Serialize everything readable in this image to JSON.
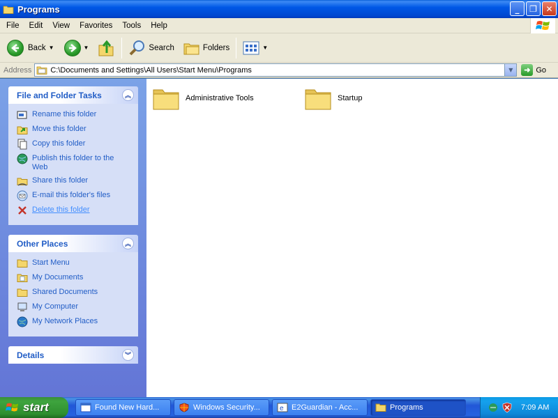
{
  "window": {
    "title": "Programs",
    "minimize_label": "_",
    "maximize_label": "❐",
    "close_label": "✕"
  },
  "menu": [
    "File",
    "Edit",
    "View",
    "Favorites",
    "Tools",
    "Help"
  ],
  "toolbar": {
    "back_label": "Back",
    "search_label": "Search",
    "folders_label": "Folders"
  },
  "address": {
    "label": "Address",
    "value": "C:\\Documents and Settings\\All Users\\Start Menu\\Programs",
    "go_label": "Go"
  },
  "file_folder_tasks": {
    "title": "File and Folder Tasks",
    "items": [
      {
        "label": "Rename this folder",
        "icon": "rename-icon"
      },
      {
        "label": "Move this folder",
        "icon": "move-icon"
      },
      {
        "label": "Copy this folder",
        "icon": "copy-icon"
      },
      {
        "label": "Publish this folder to the Web",
        "icon": "globe-icon"
      },
      {
        "label": "Share this folder",
        "icon": "share-icon"
      },
      {
        "label": "E-mail this folder's files",
        "icon": "email-icon"
      },
      {
        "label": "Delete this folder",
        "icon": "delete-icon"
      }
    ]
  },
  "other_places": {
    "title": "Other Places",
    "items": [
      {
        "label": "Start Menu",
        "icon": "folder-icon"
      },
      {
        "label": "My Documents",
        "icon": "my-documents-icon"
      },
      {
        "label": "Shared Documents",
        "icon": "folder-icon"
      },
      {
        "label": "My Computer",
        "icon": "computer-icon"
      },
      {
        "label": "My Network Places",
        "icon": "network-icon"
      }
    ]
  },
  "details": {
    "title": "Details"
  },
  "folders": [
    {
      "name": "Administrative Tools"
    },
    {
      "name": "Startup"
    }
  ],
  "taskbar": {
    "start_label": "start",
    "buttons": [
      {
        "label": "Found New Hard...",
        "icon": "window-icon"
      },
      {
        "label": "Windows Security...",
        "icon": "shield-icon"
      },
      {
        "label": "E2Guardian - Acc...",
        "icon": "browser-icon"
      },
      {
        "label": "Programs",
        "icon": "folder-icon"
      }
    ],
    "clock": "7:09 AM"
  },
  "colors": {
    "link_blue": "#215dc6",
    "pane_blue": "#7ba2e7",
    "title_blue": "#0058e6",
    "start_green": "#3ea43e"
  }
}
